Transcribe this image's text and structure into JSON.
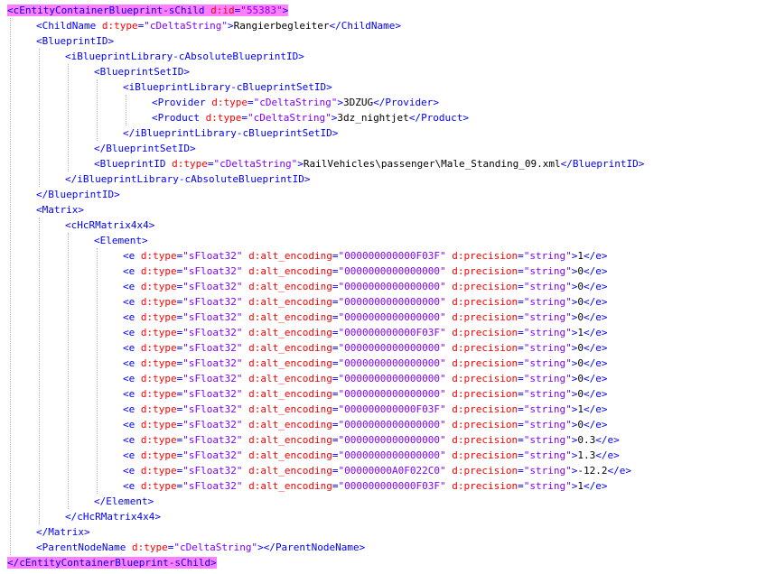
{
  "colors": {
    "tag": "#0000ff",
    "attribute": "#ff0000",
    "value": "#8000ff",
    "text": "#000000",
    "highlight": "#ff80ff",
    "guide": "#b4b4b4"
  },
  "lines": [
    {
      "indent": 0,
      "kind": "open",
      "tag": "cEntityContainerBlueprint-sChild",
      "attrs": [
        {
          "name": "d:id",
          "value": "55383"
        }
      ],
      "highlight": true
    },
    {
      "indent": 1,
      "kind": "open",
      "tag": "ChildName",
      "attrs": [
        {
          "name": "d:type",
          "value": "cDeltaString"
        }
      ],
      "text": "Rangierbegleiter",
      "close": "ChildName"
    },
    {
      "indent": 1,
      "kind": "open",
      "tag": "BlueprintID",
      "attrs": []
    },
    {
      "indent": 2,
      "kind": "open",
      "tag": "iBlueprintLibrary-cAbsoluteBlueprintID",
      "attrs": []
    },
    {
      "indent": 3,
      "kind": "open",
      "tag": "BlueprintSetID",
      "attrs": []
    },
    {
      "indent": 4,
      "kind": "open",
      "tag": "iBlueprintLibrary-cBlueprintSetID",
      "attrs": []
    },
    {
      "indent": 5,
      "kind": "open",
      "tag": "Provider",
      "attrs": [
        {
          "name": "d:type",
          "value": "cDeltaString"
        }
      ],
      "text": "3DZUG",
      "close": "Provider"
    },
    {
      "indent": 5,
      "kind": "open",
      "tag": "Product",
      "attrs": [
        {
          "name": "d:type",
          "value": "cDeltaString"
        }
      ],
      "text": "3dz_nightjet",
      "close": "Product"
    },
    {
      "indent": 4,
      "kind": "close",
      "tag": "iBlueprintLibrary-cBlueprintSetID"
    },
    {
      "indent": 3,
      "kind": "close",
      "tag": "BlueprintSetID"
    },
    {
      "indent": 3,
      "kind": "open",
      "tag": "BlueprintID",
      "attrs": [
        {
          "name": "d:type",
          "value": "cDeltaString"
        }
      ],
      "text": "RailVehicles\\passenger\\Male_Standing_09.xml",
      "close": "BlueprintID"
    },
    {
      "indent": 2,
      "kind": "close",
      "tag": "iBlueprintLibrary-cAbsoluteBlueprintID"
    },
    {
      "indent": 1,
      "kind": "close",
      "tag": "BlueprintID"
    },
    {
      "indent": 1,
      "kind": "open",
      "tag": "Matrix",
      "attrs": []
    },
    {
      "indent": 2,
      "kind": "open",
      "tag": "cHcRMatrix4x4",
      "attrs": []
    },
    {
      "indent": 3,
      "kind": "open",
      "tag": "Element",
      "attrs": []
    },
    {
      "indent": 4,
      "kind": "open",
      "tag": "e",
      "attrs": [
        {
          "name": "d:type",
          "value": "sFloat32"
        },
        {
          "name": "d:alt_encoding",
          "value": "000000000000F03F"
        },
        {
          "name": "d:precision",
          "value": "string"
        }
      ],
      "text": "1",
      "close": "e"
    },
    {
      "indent": 4,
      "kind": "open",
      "tag": "e",
      "attrs": [
        {
          "name": "d:type",
          "value": "sFloat32"
        },
        {
          "name": "d:alt_encoding",
          "value": "0000000000000000"
        },
        {
          "name": "d:precision",
          "value": "string"
        }
      ],
      "text": "0",
      "close": "e"
    },
    {
      "indent": 4,
      "kind": "open",
      "tag": "e",
      "attrs": [
        {
          "name": "d:type",
          "value": "sFloat32"
        },
        {
          "name": "d:alt_encoding",
          "value": "0000000000000000"
        },
        {
          "name": "d:precision",
          "value": "string"
        }
      ],
      "text": "0",
      "close": "e"
    },
    {
      "indent": 4,
      "kind": "open",
      "tag": "e",
      "attrs": [
        {
          "name": "d:type",
          "value": "sFloat32"
        },
        {
          "name": "d:alt_encoding",
          "value": "0000000000000000"
        },
        {
          "name": "d:precision",
          "value": "string"
        }
      ],
      "text": "0",
      "close": "e"
    },
    {
      "indent": 4,
      "kind": "open",
      "tag": "e",
      "attrs": [
        {
          "name": "d:type",
          "value": "sFloat32"
        },
        {
          "name": "d:alt_encoding",
          "value": "0000000000000000"
        },
        {
          "name": "d:precision",
          "value": "string"
        }
      ],
      "text": "0",
      "close": "e"
    },
    {
      "indent": 4,
      "kind": "open",
      "tag": "e",
      "attrs": [
        {
          "name": "d:type",
          "value": "sFloat32"
        },
        {
          "name": "d:alt_encoding",
          "value": "000000000000F03F"
        },
        {
          "name": "d:precision",
          "value": "string"
        }
      ],
      "text": "1",
      "close": "e"
    },
    {
      "indent": 4,
      "kind": "open",
      "tag": "e",
      "attrs": [
        {
          "name": "d:type",
          "value": "sFloat32"
        },
        {
          "name": "d:alt_encoding",
          "value": "0000000000000000"
        },
        {
          "name": "d:precision",
          "value": "string"
        }
      ],
      "text": "0",
      "close": "e"
    },
    {
      "indent": 4,
      "kind": "open",
      "tag": "e",
      "attrs": [
        {
          "name": "d:type",
          "value": "sFloat32"
        },
        {
          "name": "d:alt_encoding",
          "value": "0000000000000000"
        },
        {
          "name": "d:precision",
          "value": "string"
        }
      ],
      "text": "0",
      "close": "e"
    },
    {
      "indent": 4,
      "kind": "open",
      "tag": "e",
      "attrs": [
        {
          "name": "d:type",
          "value": "sFloat32"
        },
        {
          "name": "d:alt_encoding",
          "value": "0000000000000000"
        },
        {
          "name": "d:precision",
          "value": "string"
        }
      ],
      "text": "0",
      "close": "e"
    },
    {
      "indent": 4,
      "kind": "open",
      "tag": "e",
      "attrs": [
        {
          "name": "d:type",
          "value": "sFloat32"
        },
        {
          "name": "d:alt_encoding",
          "value": "0000000000000000"
        },
        {
          "name": "d:precision",
          "value": "string"
        }
      ],
      "text": "0",
      "close": "e"
    },
    {
      "indent": 4,
      "kind": "open",
      "tag": "e",
      "attrs": [
        {
          "name": "d:type",
          "value": "sFloat32"
        },
        {
          "name": "d:alt_encoding",
          "value": "000000000000F03F"
        },
        {
          "name": "d:precision",
          "value": "string"
        }
      ],
      "text": "1",
      "close": "e"
    },
    {
      "indent": 4,
      "kind": "open",
      "tag": "e",
      "attrs": [
        {
          "name": "d:type",
          "value": "sFloat32"
        },
        {
          "name": "d:alt_encoding",
          "value": "0000000000000000"
        },
        {
          "name": "d:precision",
          "value": "string"
        }
      ],
      "text": "0",
      "close": "e"
    },
    {
      "indent": 4,
      "kind": "open",
      "tag": "e",
      "attrs": [
        {
          "name": "d:type",
          "value": "sFloat32"
        },
        {
          "name": "d:alt_encoding",
          "value": "0000000000000000"
        },
        {
          "name": "d:precision",
          "value": "string"
        }
      ],
      "text": "0.3",
      "close": "e"
    },
    {
      "indent": 4,
      "kind": "open",
      "tag": "e",
      "attrs": [
        {
          "name": "d:type",
          "value": "sFloat32"
        },
        {
          "name": "d:alt_encoding",
          "value": "0000000000000000"
        },
        {
          "name": "d:precision",
          "value": "string"
        }
      ],
      "text": "1.3",
      "close": "e"
    },
    {
      "indent": 4,
      "kind": "open",
      "tag": "e",
      "attrs": [
        {
          "name": "d:type",
          "value": "sFloat32"
        },
        {
          "name": "d:alt_encoding",
          "value": "00000000A0F022C0"
        },
        {
          "name": "d:precision",
          "value": "string"
        }
      ],
      "text": "-12.2",
      "close": "e"
    },
    {
      "indent": 4,
      "kind": "open",
      "tag": "e",
      "attrs": [
        {
          "name": "d:type",
          "value": "sFloat32"
        },
        {
          "name": "d:alt_encoding",
          "value": "000000000000F03F"
        },
        {
          "name": "d:precision",
          "value": "string"
        }
      ],
      "text": "1",
      "close": "e"
    },
    {
      "indent": 3,
      "kind": "close",
      "tag": "Element"
    },
    {
      "indent": 2,
      "kind": "close",
      "tag": "cHcRMatrix4x4"
    },
    {
      "indent": 1,
      "kind": "close",
      "tag": "Matrix"
    },
    {
      "indent": 1,
      "kind": "open",
      "tag": "ParentNodeName",
      "attrs": [
        {
          "name": "d:type",
          "value": "cDeltaString"
        }
      ],
      "text": "",
      "close": "ParentNodeName"
    },
    {
      "indent": 0,
      "kind": "close",
      "tag": "cEntityContainerBlueprint-sChild",
      "highlight": true
    }
  ]
}
